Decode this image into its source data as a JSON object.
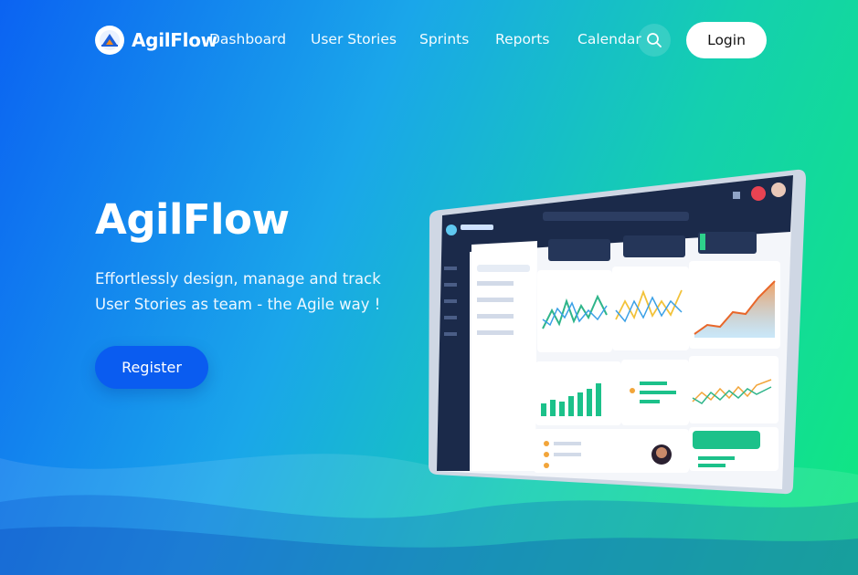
{
  "brand": {
    "name": "AgilFlow",
    "logo_icon": "agilflow-logo-icon"
  },
  "nav": {
    "links": [
      "Dashboard",
      "User Stories",
      "Sprints",
      "Reports",
      "Calendar"
    ],
    "search_icon": "search-icon",
    "login_label": "Login"
  },
  "hero": {
    "title": "AgilFlow",
    "subtitle": "Effortlessly design, manage and track User Stories as team - the Agile way !",
    "register_label": "Register"
  },
  "colors": {
    "gradient_start": "#0b63f2",
    "gradient_end": "#10e87f",
    "register_button": "#0a5cf0",
    "mockup_sidebar": "#1b2a4a"
  }
}
